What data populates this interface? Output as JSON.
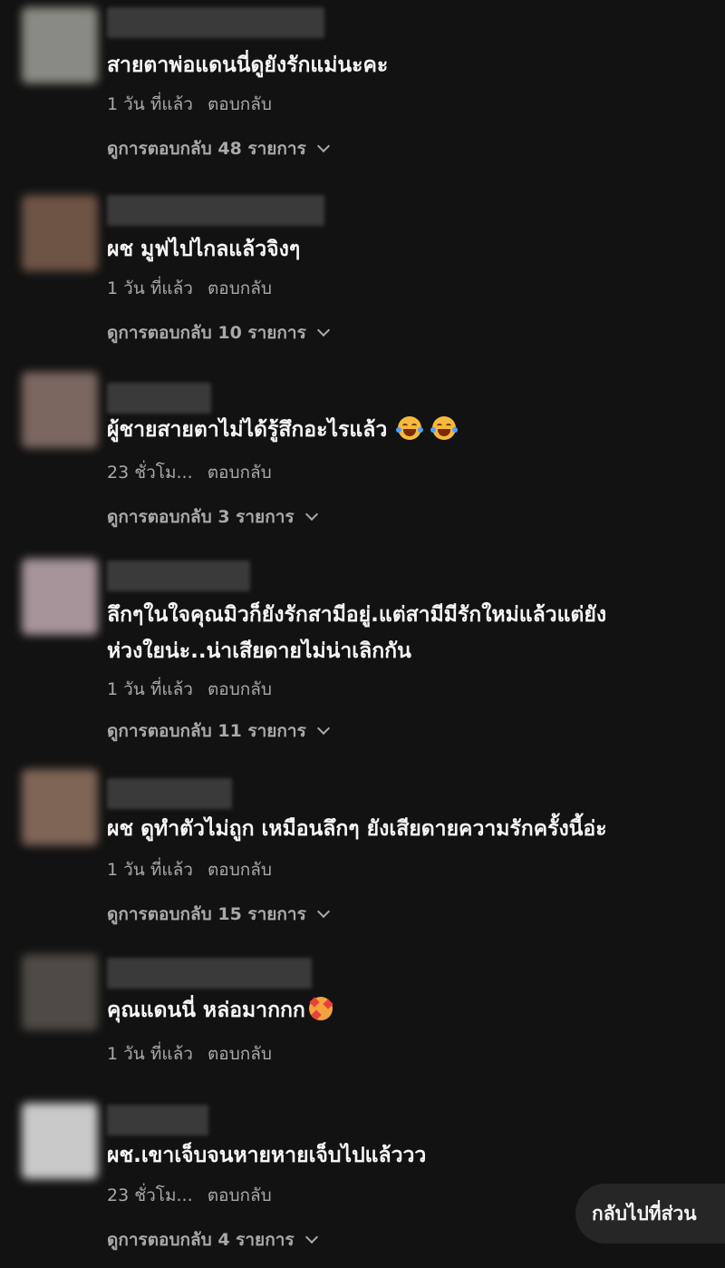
{
  "comments": [
    {
      "text": "สายตาพ่อแดนนี่ดูยังรักแม่นะคะ",
      "time": "1 วัน ที่แล้ว",
      "reply_label": "ตอบกลับ",
      "view_replies": "ดูการตอบกลับ 48 รายการ",
      "avatar_color": "#8a8a84"
    },
    {
      "text": "ผช มูฟไปไกลแล้วจิงๆ",
      "time": "1 วัน ที่แล้ว",
      "reply_label": "ตอบกลับ",
      "view_replies": "ดูการตอบกลับ 10 รายการ",
      "avatar_color": "#6e5445"
    },
    {
      "text": "ผู้ชายสายตาไม่ได้รู้สึกอะไรแล้ว",
      "emojis": [
        "laugh-crying-icon",
        "laugh-crying-icon"
      ],
      "time": "23 ชั่วโม...",
      "reply_label": "ตอบกลับ",
      "view_replies": "ดูการตอบกลับ 3 รายการ",
      "avatar_color": "#7b6660"
    },
    {
      "text": "ลึกๆในใจคุณมิวก็ยังรักสามีอยู่.แต่สามีมีรักใหม่แล้วแต่ยัง\nห่วงใยน่ะ..น่าเสียดายไม่น่าเลิกกัน",
      "time": "1 วัน ที่แล้ว",
      "reply_label": "ตอบกลับ",
      "view_replies": "ดูการตอบกลับ 11 รายการ",
      "avatar_color": "#a6949a"
    },
    {
      "text": "ผช ดูทำตัวไม่ถูก เหมือนลึกๆ ยังเสียดายความรักครั้งนี้อ่ะ",
      "time": "1 วัน ที่แล้ว",
      "reply_label": "ตอบกลับ",
      "view_replies": "ดูการตอบกลับ 15 รายการ",
      "avatar_color": "#7e6556"
    },
    {
      "text": "คุณแดนนี่ หล่อมากกก",
      "emojis": [
        "smiling-face-with-hearts-icon"
      ],
      "time": "1 วัน ที่แล้ว",
      "reply_label": "ตอบกลับ",
      "view_replies": "",
      "avatar_color": "#4e4a45"
    },
    {
      "text": "ผช.เขาเจ็บจนหายหายเจ็บไปแล้ววว",
      "time": "23 ชั่วโม...",
      "reply_label": "ตอบกลับ",
      "view_replies": "ดูการตอบกลับ 4 รายการ",
      "avatar_color": "#c9c9c9"
    }
  ],
  "back_button": {
    "label": "กลับไปที่ส่วน"
  }
}
